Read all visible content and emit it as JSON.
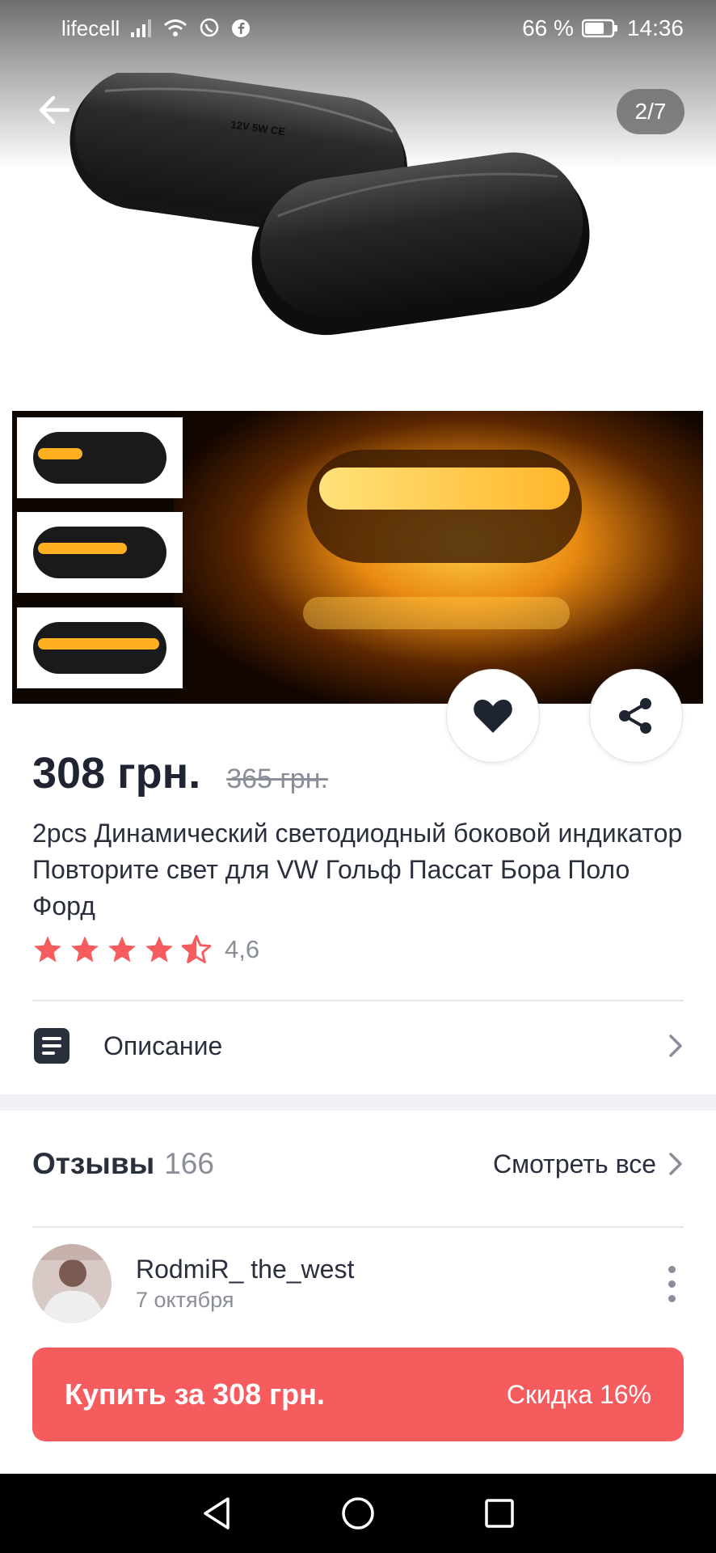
{
  "status_bar": {
    "carrier": "lifecell",
    "battery": "66 %",
    "time": "14:36",
    "icons": [
      "signal-icon",
      "wifi-icon",
      "viber-icon",
      "facebook-icon",
      "battery-icon"
    ]
  },
  "gallery": {
    "counter": "2/7",
    "label_12v": "12V 5W CE",
    "current_image": 2,
    "total_images": 7
  },
  "product": {
    "price": "308 грн.",
    "old_price": "365 грн.",
    "title": "2pcs Динамический светодиодный боковой индикатор Повторите свет для VW Гольф Пассат Бора Поло Форд",
    "rating": 4.6,
    "rating_text": "4,6",
    "rating_color": "#f65b5e"
  },
  "description": {
    "label": "Описание"
  },
  "reviews": {
    "title": "Отзывы",
    "count": "166",
    "see_all": "Смотреть все",
    "items": [
      {
        "user": "RodmiR_ the_west",
        "date": "7 октября"
      }
    ]
  },
  "buy": {
    "label": "Купить за 308 грн.",
    "discount": "Скидка 16%",
    "color": "#f65b5e"
  }
}
